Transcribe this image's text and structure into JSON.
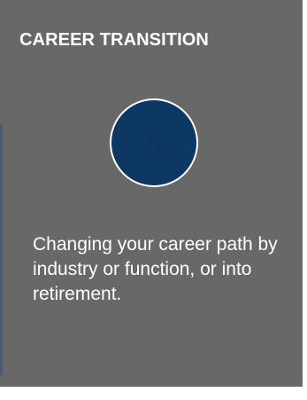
{
  "card": {
    "title": "CAREER TRANSITION",
    "icon": "missing-glyph-icon",
    "description": "Changing your career path by industry or function, or into retirement."
  },
  "colors": {
    "card_background": "#686868",
    "circle_fill": "#0d3864",
    "circle_border": "#ffffff",
    "text": "#ffffff"
  }
}
